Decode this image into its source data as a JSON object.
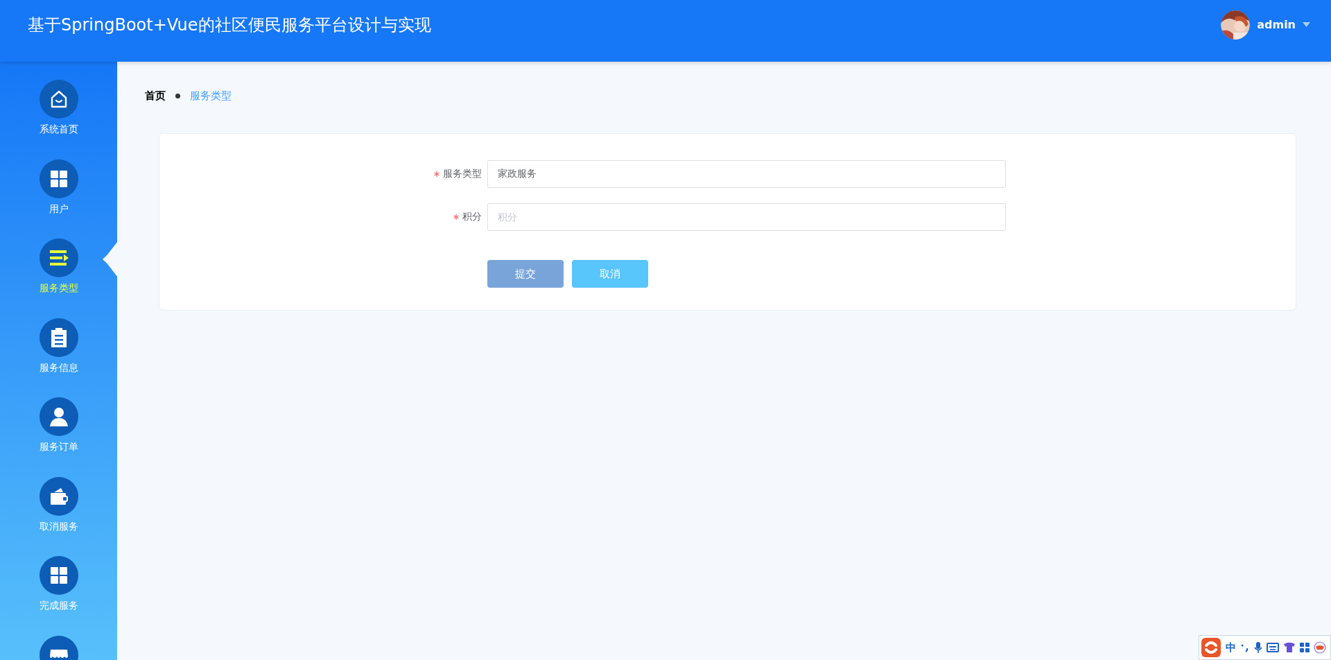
{
  "header": {
    "title": "基于SpringBoot+Vue的社区便民服务平台设计与实现",
    "user": {
      "name": "admin"
    }
  },
  "sidebar": {
    "items": [
      {
        "label": "系统首页",
        "kind": "home",
        "selected": false
      },
      {
        "label": "用户",
        "kind": "grid",
        "selected": false
      },
      {
        "label": "服务类型",
        "kind": "list",
        "selected": true
      },
      {
        "label": "服务信息",
        "kind": "clipboard",
        "selected": false
      },
      {
        "label": "服务订单",
        "kind": "person",
        "selected": false
      },
      {
        "label": "取消服务",
        "kind": "wallet",
        "selected": false
      },
      {
        "label": "完成服务",
        "kind": "grid",
        "selected": false
      },
      {
        "kind": "shop",
        "selected": false
      }
    ]
  },
  "breadcrumb": [
    {
      "label": "首页",
      "selected": false
    },
    {
      "label": "服务类型",
      "selected": true
    }
  ],
  "form": {
    "fields": [
      {
        "label": "服务类型",
        "required": true,
        "value": "家政服务"
      },
      {
        "label": "积分",
        "required": true,
        "placeholder": "积分"
      }
    ],
    "buttons": [
      {
        "label": "提交",
        "kind": "submit"
      },
      {
        "label": "取消",
        "kind": "cancel"
      }
    ]
  },
  "ime_bar": {
    "mode": "中"
  }
}
